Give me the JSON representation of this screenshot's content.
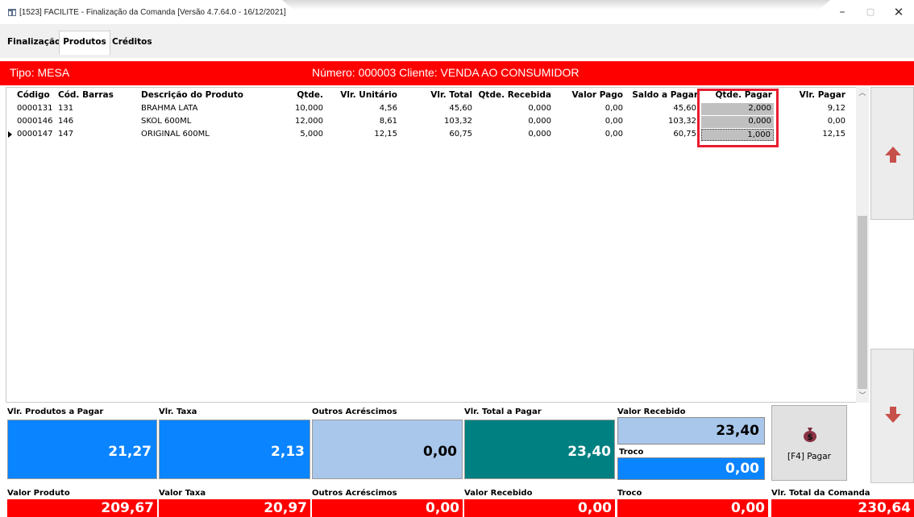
{
  "window": {
    "title": "[1523] FACILITE - Finalização da Comanda [Versão 4.7.64.0 - 16/12/2021]",
    "minimize": "–",
    "maximize": "▢",
    "close": "✕"
  },
  "tabs": [
    "Finalização",
    "Produtos",
    "Créditos"
  ],
  "header": {
    "tipo": "Tipo: MESA",
    "numero": "Número: 000003  Cliente: VENDA AO CONSUMIDOR"
  },
  "grid": {
    "columns": [
      "Código",
      "Cód. Barras",
      "Descrição do Produto",
      "Qtde.",
      "Vlr. Unitário",
      "Vlr. Total",
      "Qtde. Recebida",
      "Valor Pago",
      "Saldo a Pagar",
      "Qtde. Pagar",
      "Vlr. Pagar"
    ],
    "rows": [
      [
        "0000131",
        "131",
        "BRAHMA LATA",
        "10,000",
        "4,56",
        "45,60",
        "0,000",
        "0,00",
        "45,60",
        "2,000",
        "9,12"
      ],
      [
        "0000146",
        "146",
        "SKOL 600ML",
        "12,000",
        "8,61",
        "103,32",
        "0,000",
        "0,00",
        "103,32",
        "0,000",
        "0,00"
      ],
      [
        "0000147",
        "147",
        "ORIGINAL 600ML",
        "5,000",
        "12,15",
        "60,75",
        "0,000",
        "0,00",
        "60,75",
        "1,000",
        "12,15"
      ]
    ]
  },
  "summary": {
    "produtos_pagar": {
      "label": "Vlr. Produtos a Pagar",
      "value": "21,27"
    },
    "taxa": {
      "label": "Vlr. Taxa",
      "value": "2,13"
    },
    "acrescimos": {
      "label": "Outros Acréscimos",
      "value": "0,00"
    },
    "total_pagar": {
      "label": "Vlr. Total a Pagar",
      "value": "23,40"
    },
    "recebido": {
      "label": "Valor Recebido",
      "value": "23,40"
    },
    "troco": {
      "label": "Troco",
      "value": "0,00"
    },
    "pay_button": "[F4] Pagar"
  },
  "totals": {
    "valor_produto": {
      "label": "Valor Produto",
      "value": "209,67"
    },
    "valor_taxa": {
      "label": "Valor Taxa",
      "value": "20,97"
    },
    "acrescimos": {
      "label": "Outros Acréscimos",
      "value": "0,00"
    },
    "valor_recebido": {
      "label": "Valor Recebido",
      "value": "0,00"
    },
    "troco": {
      "label": "Troco",
      "value": "0,00"
    },
    "total_comanda": {
      "label": "Vlr. Total da Comanda",
      "value": "230,64"
    }
  },
  "icons": {
    "app": "app-icon",
    "scroll_up": "up-arrow-icon",
    "scroll_down": "down-arrow-icon",
    "pay": "money-bag-icon"
  },
  "colors": {
    "header_red": "#ff0000",
    "blue": "#0a84ff",
    "light_blue": "#a9c7ea",
    "teal": "#008080",
    "arrow": "#c8504a",
    "highlight": "#e81c2e"
  }
}
